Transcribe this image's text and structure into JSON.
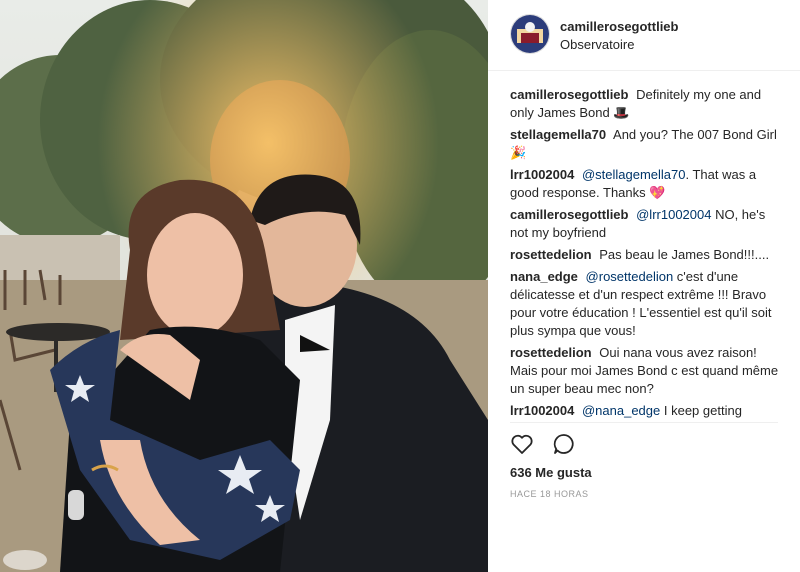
{
  "post": {
    "username": "camillerosegottlieb",
    "location": "Observatoire"
  },
  "comments": [
    {
      "user": "camillerosegottlieb",
      "text": "Definitely my one and only James Bond 🎩",
      "mention": ""
    },
    {
      "user": "stellagemella70",
      "text": "And you? The 007 Bond Girl 🎉",
      "mention": ""
    },
    {
      "user": "lrr1002004",
      "mention": "@stellagemella70",
      "text": ". That was a good response. Thanks 💖"
    },
    {
      "user": "camillerosegottlieb",
      "mention": "@lrr1002004",
      "text": " NO, he's not my boyfriend"
    },
    {
      "user": "rosettedelion",
      "text": "Pas beau le James Bond!!!....",
      "mention": ""
    },
    {
      "user": "nana_edge",
      "mention": "@rosettedelion",
      "text": " c'est d'une délicatesse et d'un respect extrême !!! Bravo pour votre éducation ! L'essentiel est qu'il soit plus sympa que vous!"
    },
    {
      "user": "rosettedelion",
      "text": "Oui nana vous avez raison! Mais pour moi James Bond c est quand même un super beau mec non?",
      "mention": ""
    },
    {
      "user": "lrr1002004",
      "mention": "@nana_edge",
      "text": " I keep getting"
    }
  ],
  "actions": {
    "like_icon": "heart-icon",
    "comment_icon": "comment-icon"
  },
  "likes_text": "636 Me gusta",
  "timestamp": "HACE 18 HORAS",
  "colors": {
    "mention": "#003569",
    "text": "#262626",
    "muted": "#999999"
  }
}
